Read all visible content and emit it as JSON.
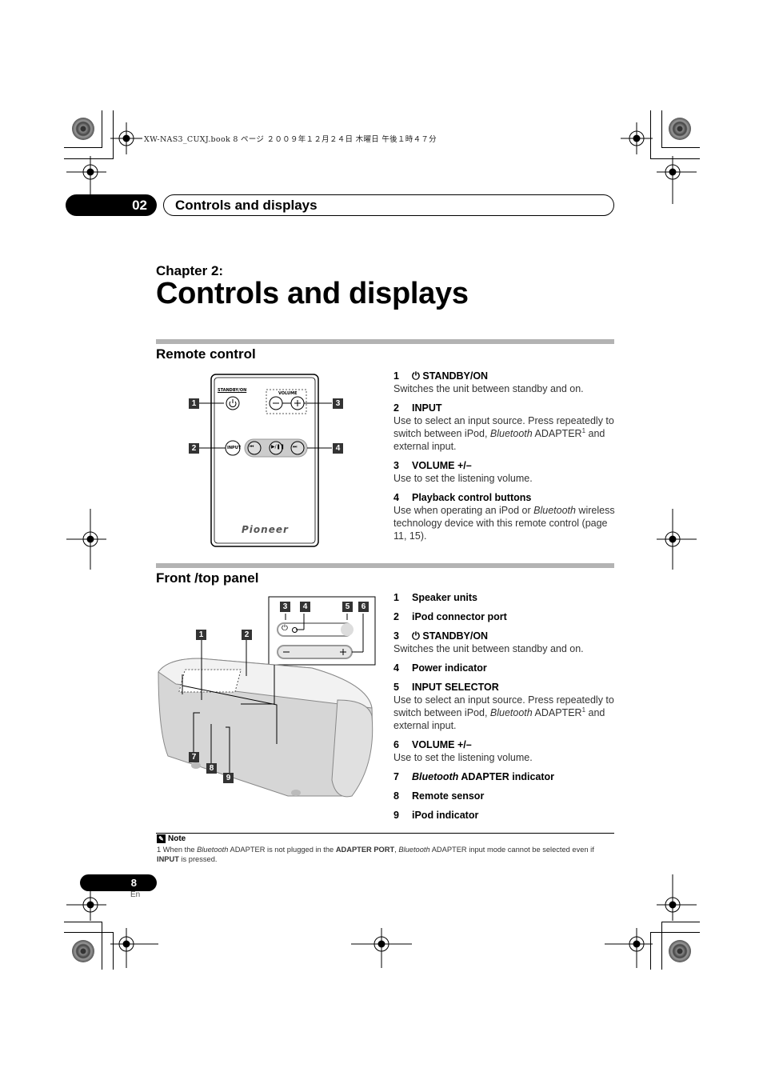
{
  "print_header": "XW-NAS3_CUXJ.book  8 ページ  ２００９年１２月２４日  木曜日  午後１時４７分",
  "chapter_tab": {
    "number": "02",
    "title": "Controls and displays"
  },
  "chapter": {
    "label": "Chapter 2:",
    "title": "Controls and displays"
  },
  "remote_section": {
    "title": "Remote control",
    "diagram": {
      "standby_label": "STANDBY/ON",
      "volume_label": "VOLUME",
      "input_label": "INPUT",
      "brand": "Pioneer",
      "callouts": [
        "1",
        "2",
        "3",
        "4"
      ]
    },
    "items": [
      {
        "num": "1",
        "icon": "power-icon",
        "title": "STANDBY/ON",
        "desc": "Switches the unit between standby and on."
      },
      {
        "num": "2",
        "title": "INPUT",
        "desc_parts": [
          "Use to select an input source. Press repeatedly to switch between iPod, ",
          "Bluetooth",
          " ADAPTER",
          "1",
          " and external input."
        ]
      },
      {
        "num": "3",
        "title": "VOLUME +/–",
        "desc": "Use to set the listening volume."
      },
      {
        "num": "4",
        "title": "Playback control buttons",
        "desc_parts": [
          "Use when operating an iPod or ",
          "Bluetooth",
          " wireless technology device with this remote control (page 11, 15)."
        ]
      }
    ]
  },
  "front_section": {
    "title": "Front /top panel",
    "diagram": {
      "callouts": [
        "1",
        "2",
        "3",
        "4",
        "5",
        "6",
        "7",
        "8",
        "9"
      ]
    },
    "items": [
      {
        "num": "1",
        "title": "Speaker units"
      },
      {
        "num": "2",
        "title": "iPod connector port"
      },
      {
        "num": "3",
        "icon": "power-icon",
        "title": "STANDBY/ON",
        "desc": "Switches the unit between standby and on."
      },
      {
        "num": "4",
        "title": "Power indicator"
      },
      {
        "num": "5",
        "title": "INPUT SELECTOR",
        "desc_parts": [
          "Use to select an input source. Press repeatedly to switch between iPod, ",
          "Bluetooth",
          " ADAPTER",
          "1",
          " and external input."
        ]
      },
      {
        "num": "6",
        "title": "VOLUME +/–",
        "desc": "Use to set the listening volume."
      },
      {
        "num": "7",
        "title_italic": "Bluetooth",
        "title": " ADAPTER indicator"
      },
      {
        "num": "8",
        "title": "Remote sensor"
      },
      {
        "num": "9",
        "title": "iPod indicator"
      }
    ]
  },
  "note": {
    "heading": "Note",
    "parts": [
      "1 When the ",
      "Bluetooth",
      " ADAPTER is not plugged in the ",
      "ADAPTER PORT",
      ", ",
      "Bluetooth",
      " ADAPTER input mode cannot be selected even if ",
      "INPUT",
      " is pressed."
    ]
  },
  "footer": {
    "page": "8",
    "lang": "En"
  }
}
